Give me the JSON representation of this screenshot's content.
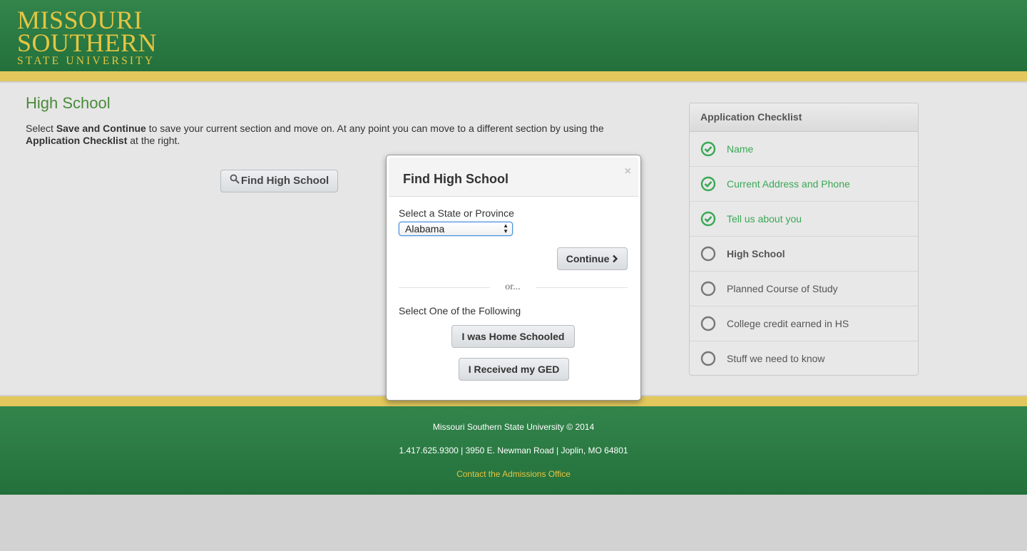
{
  "header": {
    "logo_line1": "MISSOURI",
    "logo_line2": "SOUTHERN",
    "logo_line3": "STATE UNIVERSITY"
  },
  "main": {
    "title": "High School",
    "intro_pre": "Select ",
    "intro_bold1": "Save and Continue",
    "intro_mid": " to save your current section and move on. At any point you can move to a different section by using the ",
    "intro_bold2": "Application Checklist",
    "intro_post": " at the right.",
    "find_button": "Find High School"
  },
  "checklist": {
    "title": "Application Checklist",
    "items": [
      {
        "label": "Name",
        "status": "done"
      },
      {
        "label": "Current Address and Phone",
        "status": "done"
      },
      {
        "label": "Tell us about you",
        "status": "done"
      },
      {
        "label": "High School",
        "status": "current"
      },
      {
        "label": "Planned Course of Study",
        "status": "todo"
      },
      {
        "label": "College credit earned in HS",
        "status": "todo"
      },
      {
        "label": "Stuff we need to know",
        "status": "todo"
      }
    ]
  },
  "modal": {
    "title": "Find High School",
    "close": "×",
    "state_label": "Select a State or Province",
    "state_value": "Alabama",
    "continue": "Continue",
    "or": "or...",
    "select_label": "Select One of the Following",
    "home_schooled": "I was Home Schooled",
    "ged": "I Received my GED"
  },
  "footer": {
    "copyright": "Missouri Southern State University © 2014",
    "contact_line": "1.417.625.9300 | 3950 E. Newman Road | Joplin, MO 64801",
    "admissions_link": "Contact the Admissions Office"
  },
  "colors": {
    "green": "#2c7d45",
    "gold": "#e6c542",
    "check_green": "#3aa856"
  }
}
